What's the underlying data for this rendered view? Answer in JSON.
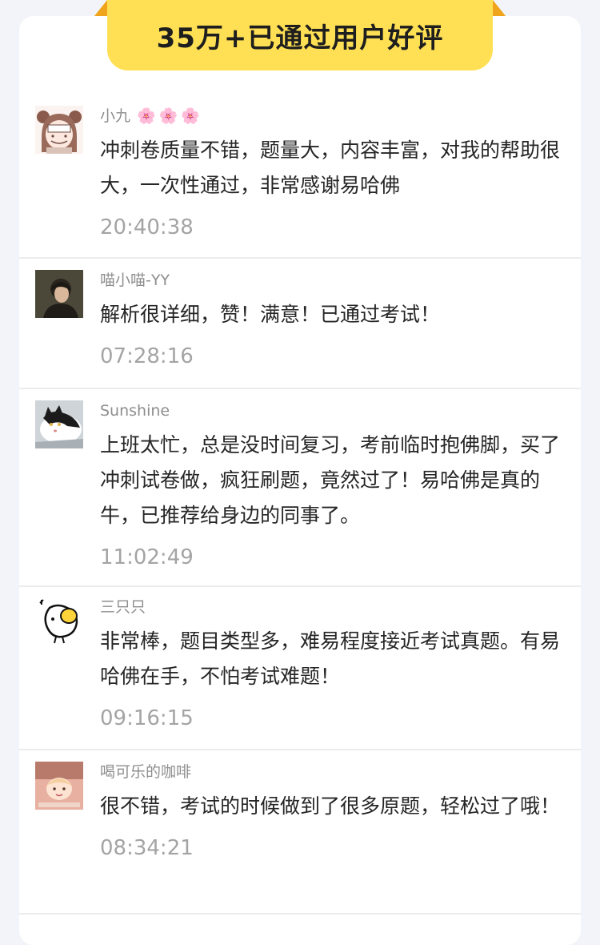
{
  "header": {
    "title": "35万+已通过用户好评"
  },
  "reviews": [
    {
      "avatar_icon": "anime-girl-avatar-icon",
      "username": "小九",
      "username_decoration": "🌸🌸🌸",
      "comment": "冲刺卷质量不错，题量大，内容丰富，对我的帮助很大，一次性通过，非常感谢易哈佛",
      "time": "20:40:38"
    },
    {
      "avatar_icon": "dark-portrait-avatar-icon",
      "username": "喵小喵-YY",
      "comment": "解析很详细，赞！满意！已通过考试！",
      "time": "07:28:16"
    },
    {
      "avatar_icon": "cat-avatar-icon",
      "username": "Sunshine",
      "comment": "上班太忙，总是没时间复习，考前临时抱佛脚，买了冲刺试卷做，疯狂刷题，竟然过了！易哈佛是真的牛，已推荐给身边的同事了。",
      "time": "11:02:49"
    },
    {
      "avatar_icon": "cartoon-chick-avatar-icon",
      "username": "三只只",
      "comment": "非常棒，题目类型多，难易程度接近考试真题。有易哈佛在手，不怕考试难题！",
      "time": "09:16:15"
    },
    {
      "avatar_icon": "cartoon-baby-avatar-icon",
      "username": "喝可乐的咖啡",
      "comment": "很不错，考试的时候做到了很多原题，轻松过了哦！",
      "time": "08:34:21"
    }
  ],
  "colors": {
    "ribbon": "#ffe054",
    "ribbon_ear": "#f0a41c",
    "page_background": "#f3f4f9",
    "card_background": "#ffffff",
    "comment_text": "#262626",
    "meta_text": "#8e8e8e"
  }
}
